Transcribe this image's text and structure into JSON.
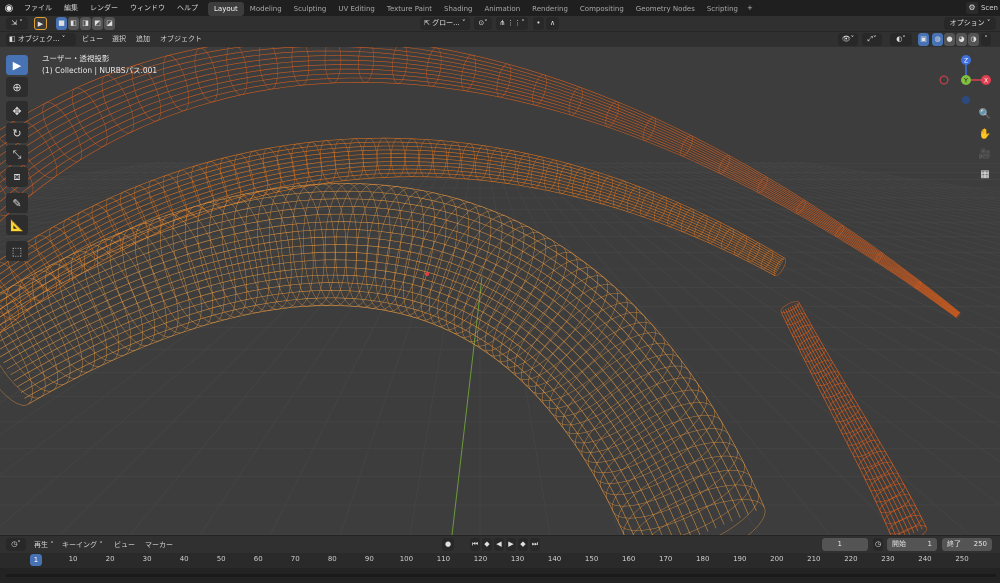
{
  "menu": [
    "ファイル",
    "編集",
    "レンダー",
    "ウィンドウ",
    "ヘルプ"
  ],
  "workspace_tabs": [
    "Layout",
    "Modeling",
    "Sculpting",
    "UV Editing",
    "Texture Paint",
    "Shading",
    "Animation",
    "Rendering",
    "Compositing",
    "Geometry Nodes",
    "Scripting"
  ],
  "active_tab": "Layout",
  "scene_label": "Scen",
  "tool_header": {
    "transform_orientation": "グロー...",
    "options": "オプション"
  },
  "view_header": {
    "mode": "オブジェク...",
    "view": "ビュー",
    "select": "選択",
    "add": "追加",
    "object": "オブジェクト"
  },
  "viewport": {
    "view_name": "ユーザー・透視投影",
    "object_info": "(1) Collection | NURBSパス.001"
  },
  "gizmo": {
    "x": "X",
    "y": "Y",
    "z": "Z"
  },
  "timeline": {
    "playback": "再生",
    "keying": "キーイング",
    "view": "ビュー",
    "marker": "マーカー",
    "current_frame": "1",
    "start_label": "開始",
    "start": "1",
    "end_label": "終了",
    "end": "250"
  },
  "ruler_ticks": [
    "1",
    "10",
    "20",
    "30",
    "40",
    "50",
    "60",
    "70",
    "80",
    "90",
    "100",
    "110",
    "120",
    "130",
    "140",
    "150",
    "160",
    "170",
    "180",
    "190",
    "200",
    "210",
    "220",
    "230",
    "240",
    "250"
  ],
  "colors": {
    "accent": "#4772b3",
    "wire_orange": "#f07a1a",
    "wire_dark": "#e8621a",
    "wire_light": "#f5a040",
    "grid": "#474747",
    "viewport_bg": "#3d3d3d",
    "axis_x": "#e04050",
    "axis_y": "#80c040",
    "axis_z": "#4070e0"
  }
}
